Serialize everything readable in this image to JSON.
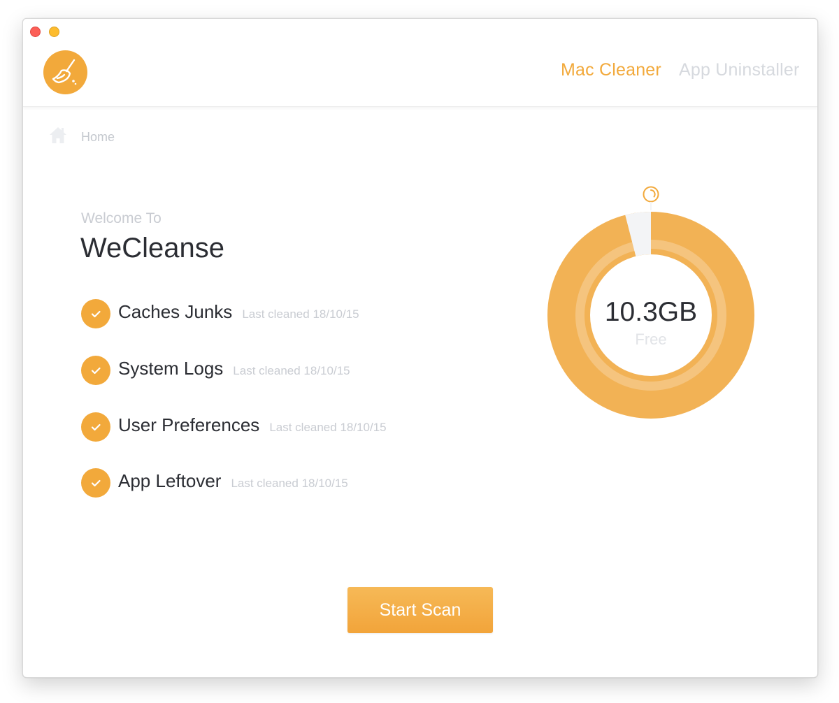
{
  "window": {
    "controls": [
      "close",
      "minimize"
    ]
  },
  "header": {
    "logo_icon": "broom-icon",
    "nav": {
      "mac_cleaner": "Mac Cleaner",
      "app_uninstaller": "App Uninstaller"
    }
  },
  "breadcrumb": {
    "icon": "home-icon",
    "label": "Home"
  },
  "main": {
    "welcome": "Welcome To",
    "title": "WeCleanse",
    "items": [
      {
        "label": "Caches Junks",
        "last_cleaned": "Last cleaned 18/10/15"
      },
      {
        "label": "System Logs",
        "last_cleaned": "Last cleaned 18/10/15"
      },
      {
        "label": "User Preferences",
        "last_cleaned": "Last cleaned 18/10/15"
      },
      {
        "label": "App Leftover",
        "last_cleaned": "Last cleaned 18/10/15"
      }
    ]
  },
  "disk": {
    "free_value": "10.3GB",
    "free_label": "Free",
    "free_fraction": 0.04,
    "indicator_icon": "spinner-icon"
  },
  "actions": {
    "start_scan": "Start Scan"
  },
  "colors": {
    "accent": "#f2a93b",
    "inactive_nav": "#d6d9de",
    "muted_text": "#c9ccd2",
    "dark_text": "#2b2d33",
    "close": "#fc5f57",
    "minimize": "#fdbc2e"
  }
}
